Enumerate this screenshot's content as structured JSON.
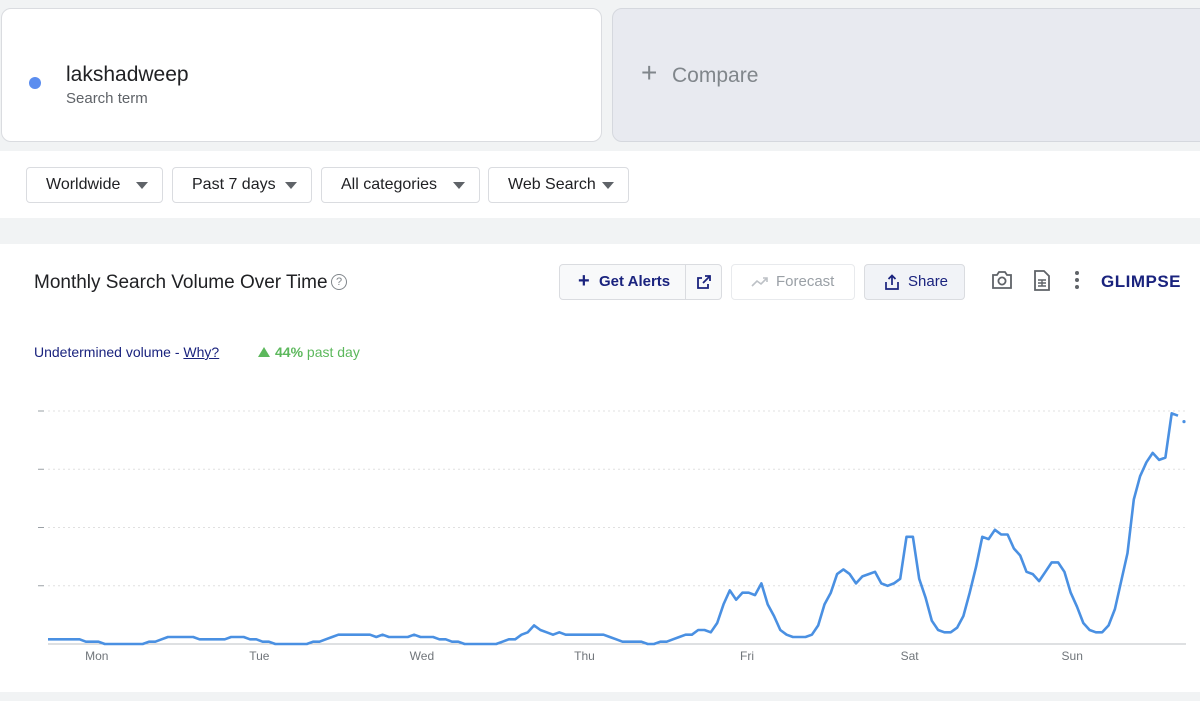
{
  "search_term": {
    "name": "lakshadweep",
    "label": "Search term",
    "color": "#5b8def"
  },
  "compare": {
    "label": "Compare"
  },
  "filters": [
    {
      "label": "Worldwide"
    },
    {
      "label": "Past 7 days"
    },
    {
      "label": "All categories"
    },
    {
      "label": "Web Search"
    }
  ],
  "chart_header": {
    "title": "Monthly Search Volume Over Time",
    "get_alerts": "Get Alerts",
    "forecast": "Forecast",
    "share": "Share",
    "brand": "GLIMPSE"
  },
  "volume_note": {
    "text": "Undetermined volume - ",
    "link": "Why?"
  },
  "trend": {
    "value": "44%",
    "suffix": " past day",
    "color": "#5cb85c"
  },
  "chart_data": {
    "type": "line",
    "xlabel": "",
    "ylabel": "",
    "x_tick_labels": [
      "Mon",
      "Tue",
      "Wed",
      "Thu",
      "Fri",
      "Sat",
      "Sun"
    ],
    "y_range": [
      0,
      100
    ],
    "grid": true,
    "line_color": "#4a90e2",
    "series": [
      {
        "values": [
          2,
          2,
          2,
          2,
          2,
          2,
          1,
          1,
          1,
          0,
          0,
          0,
          0,
          0,
          0,
          0,
          1,
          1,
          2,
          3,
          3,
          3,
          3,
          3,
          2,
          2,
          2,
          2,
          2,
          3,
          3,
          3,
          2,
          2,
          1,
          1,
          0,
          0,
          0,
          0,
          0,
          0,
          1,
          1,
          2,
          3,
          4,
          4,
          4,
          4,
          4,
          4,
          3,
          4,
          3,
          3,
          3,
          3,
          4,
          3,
          3,
          3,
          2,
          2,
          1,
          1,
          0,
          0,
          0,
          0,
          0,
          0,
          1,
          2,
          2,
          4,
          5,
          8,
          6,
          5,
          4,
          5,
          4,
          4,
          4,
          4,
          4,
          4,
          4,
          3,
          2,
          1,
          1,
          1,
          1,
          0,
          0,
          1,
          1,
          2,
          3,
          4,
          4,
          6,
          6,
          5,
          9,
          17,
          23,
          19,
          22,
          22,
          21,
          26,
          17,
          12,
          6,
          4,
          3,
          3,
          3,
          4,
          8,
          17,
          22,
          30,
          32,
          30,
          26,
          29,
          30,
          31,
          26,
          25,
          26,
          28,
          46,
          46,
          28,
          20,
          10,
          6,
          5,
          5,
          7,
          12,
          22,
          33,
          46,
          45,
          49,
          47,
          47,
          41,
          38,
          31,
          30,
          27,
          31,
          35,
          35,
          31,
          22,
          16,
          9,
          6,
          5,
          5,
          8,
          15,
          27,
          39,
          62,
          72,
          78,
          82,
          79,
          80,
          99,
          98
        ]
      }
    ]
  }
}
